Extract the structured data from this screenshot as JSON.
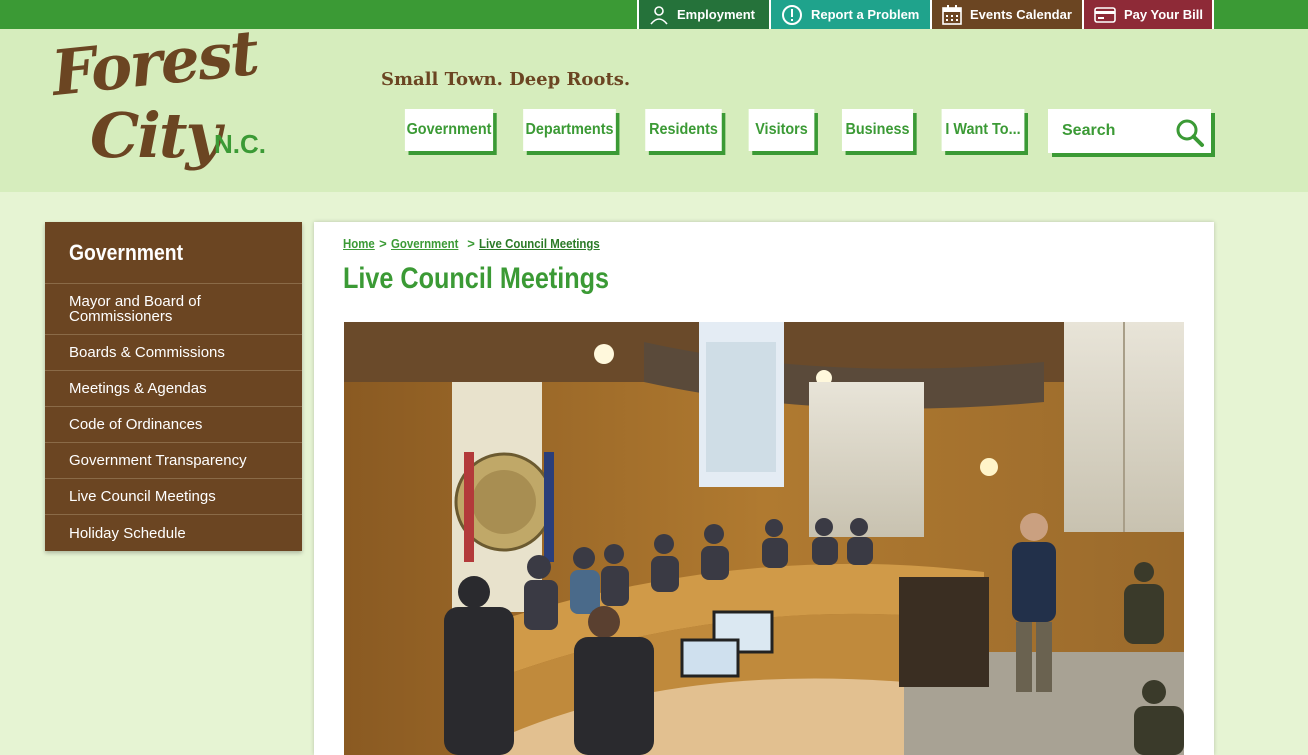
{
  "utility": {
    "employment": "Employment",
    "report": "Report a Problem",
    "events": "Events Calendar",
    "pay": "Pay Your Bill"
  },
  "logo": {
    "line1": "Forest",
    "line2": "City",
    "suffix": "N.C."
  },
  "tagline": "Small Town. Deep Roots.",
  "nav": {
    "government": "Government",
    "departments": "Departments",
    "residents": "Residents",
    "visitors": "Visitors",
    "business": "Business",
    "i_want_to": "I Want To..."
  },
  "search": {
    "placeholder": "Search"
  },
  "sidebar": {
    "title": "Government",
    "items": [
      "Mayor and Board of Commissioners",
      "Boards & Commissions",
      "Meetings & Agendas",
      "Code of Ordinances",
      "Government Transparency",
      "Live Council Meetings",
      "Holiday Schedule"
    ]
  },
  "breadcrumb": {
    "home": "Home",
    "government": "Government",
    "current": "Live Council Meetings",
    "separator": ">"
  },
  "page": {
    "title": "Live Council Meetings"
  },
  "colors": {
    "brand_green": "#3b9a35",
    "brand_brown": "#6b4522",
    "teal": "#1fa38c",
    "maroon": "#8e2a37",
    "header_bg": "#d6edbd",
    "page_bg": "#e6f4d3"
  }
}
